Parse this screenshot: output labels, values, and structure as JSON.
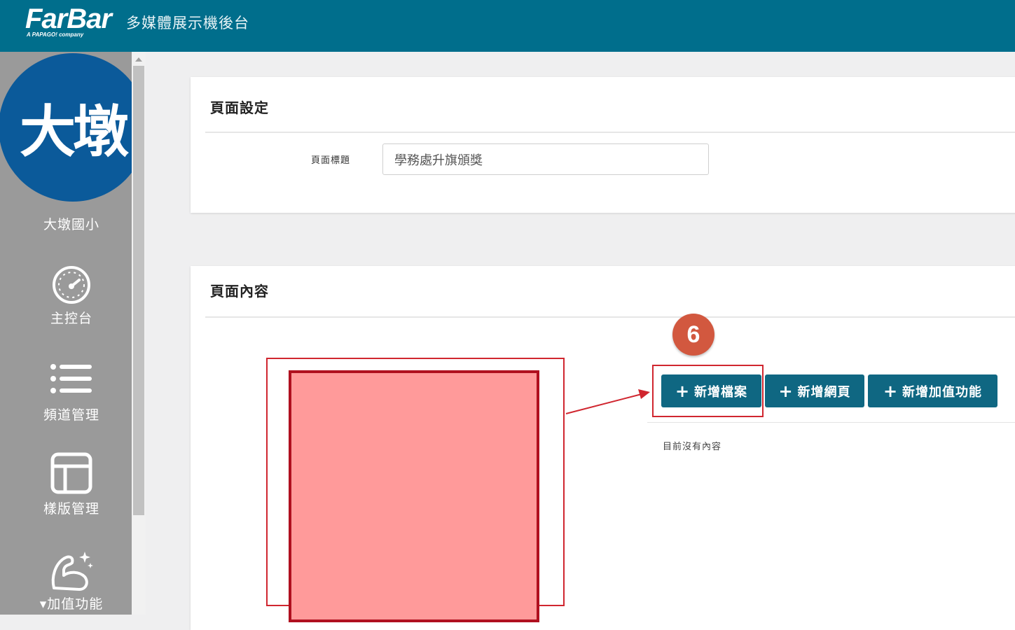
{
  "header": {
    "logo": "FarBar",
    "logo_sub": "A PAPAGO! company",
    "app_title": "多媒體展示機後台",
    "bg_color": "#006e8c"
  },
  "sidebar": {
    "avatar_text": "大墩",
    "school_name": "大墩國小",
    "items": [
      {
        "label": "主控台",
        "icon": "dashboard-gauge-icon"
      },
      {
        "label": "頻道管理",
        "icon": "list-icon"
      },
      {
        "label": "樣版管理",
        "icon": "layout-template-icon"
      },
      {
        "label": "▾加值功能",
        "icon": "strength-sparkle-icon"
      }
    ]
  },
  "page_settings": {
    "title": "頁面設定",
    "field_label": "頁面標題",
    "field_value": "學務處升旗頒獎"
  },
  "page_content": {
    "title": "頁面內容",
    "buttons": [
      {
        "label": "新增檔案"
      },
      {
        "label": "新增網頁"
      },
      {
        "label": "新增加值功能"
      }
    ],
    "empty_message": "目前沒有內容",
    "button_color": "#0f6782"
  },
  "annotation": {
    "step_number": "6",
    "color": "#d0262f"
  }
}
